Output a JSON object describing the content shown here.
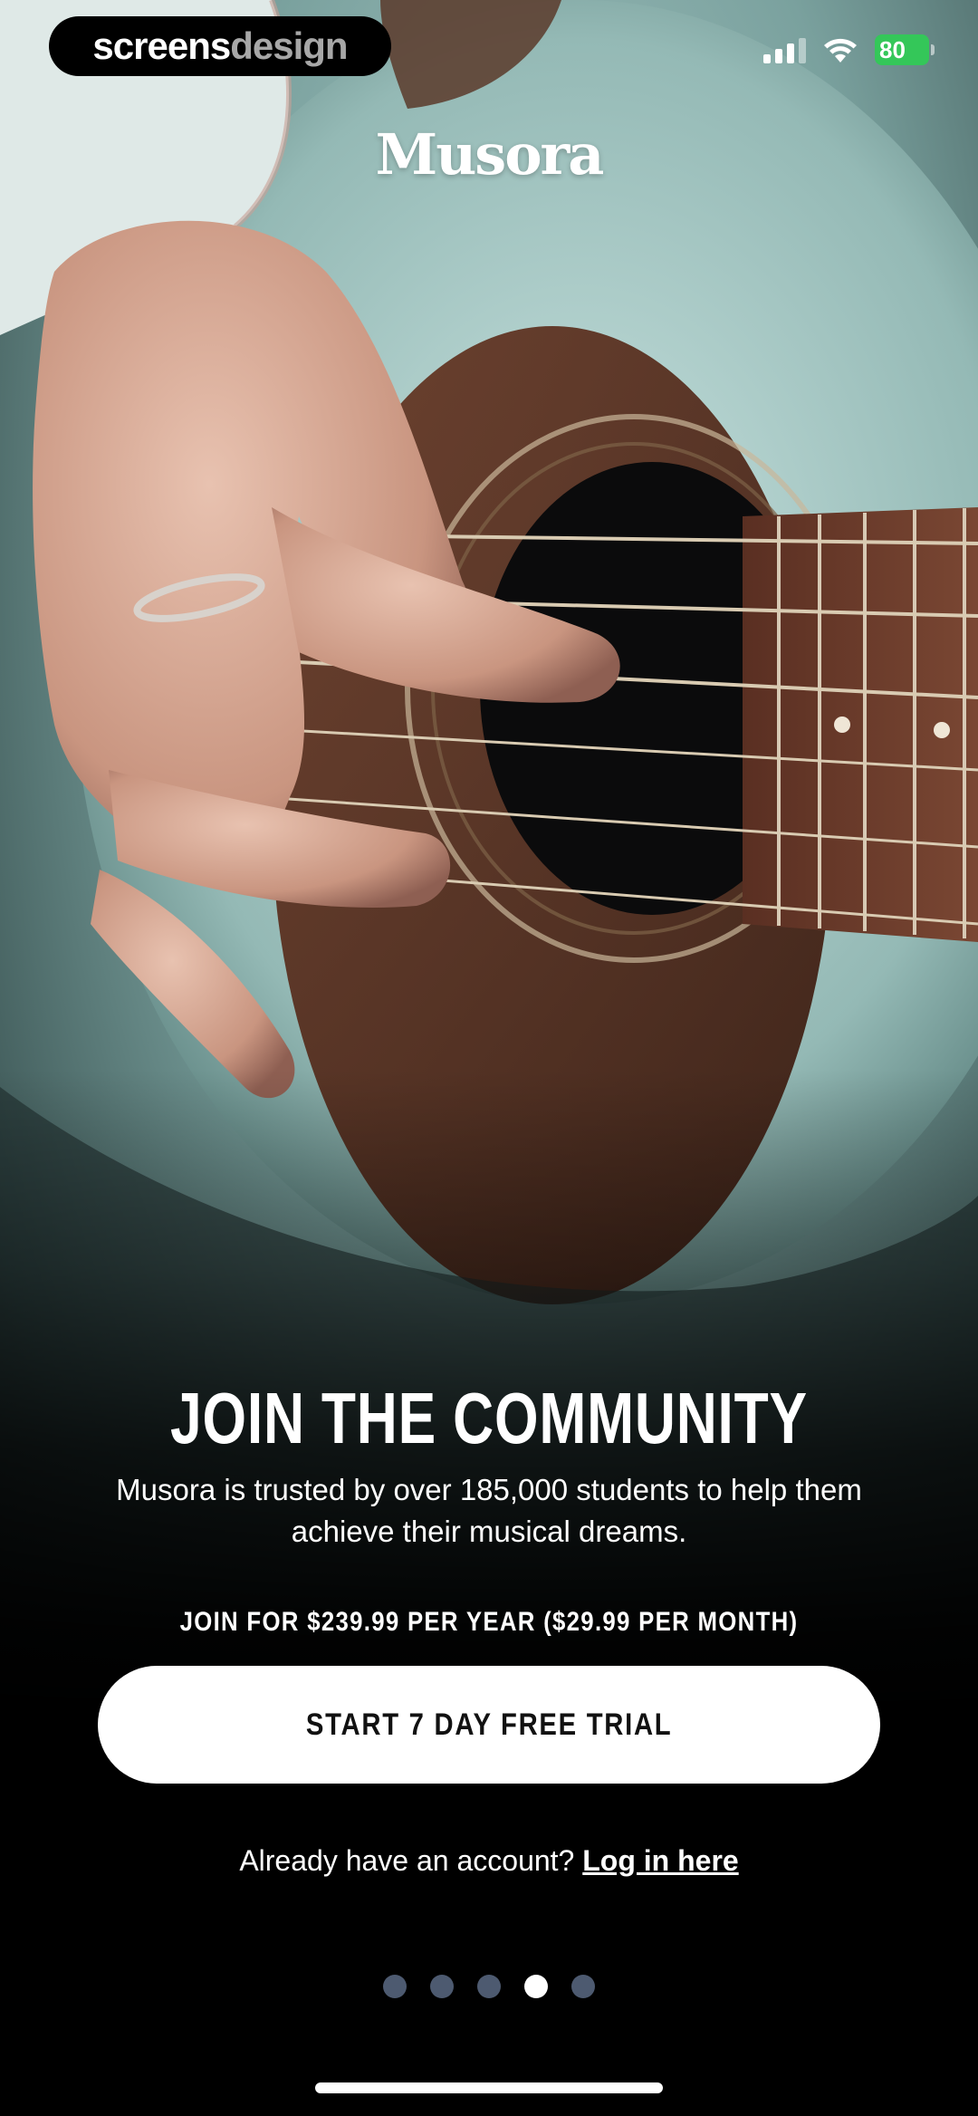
{
  "status_bar": {
    "watermark_part1": "screens",
    "watermark_part2": "design",
    "signal_icon": "signal-bars-icon",
    "wifi_icon": "wifi-icon",
    "battery_level": "80",
    "battery_color": "#34c759"
  },
  "brand": {
    "logo_text": "Musora"
  },
  "hero": {
    "title": "JOIN THE COMMUNITY",
    "subtitle": "Musora is trusted by over 185,000 students to help them achieve their musical dreams."
  },
  "pricing": {
    "text": "JOIN FOR $239.99 PER YEAR ($29.99 PER MONTH)"
  },
  "cta": {
    "label": "START 7 DAY FREE TRIAL"
  },
  "login": {
    "prompt": "Already have an account?",
    "link_label": "Log in here"
  },
  "pagination": {
    "total": 5,
    "active_index": 3,
    "active_color": "#ffffff",
    "inactive_color": "#4d5a70"
  }
}
